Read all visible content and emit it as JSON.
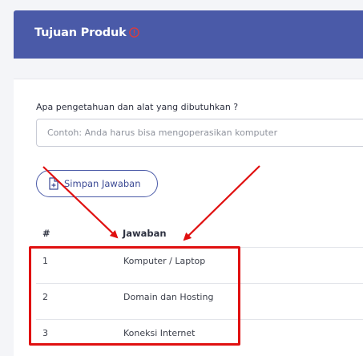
{
  "header": {
    "title": "Tujuan Produk",
    "info_icon": "info-circle-icon",
    "colors": {
      "background": "#4a5aa8",
      "info_icon": "#e53935"
    }
  },
  "form": {
    "question": "Apa pengetahuan dan alat yang dibutuhkan ?",
    "input_value": "",
    "input_placeholder": "Contoh: Anda harus bisa mengoperasikan komputer",
    "save_button_label": "Simpan Jawaban",
    "save_button_icon": "add-file-icon"
  },
  "table": {
    "columns": [
      "#",
      "Jawaban"
    ],
    "rows": [
      {
        "num": "1",
        "answer": "Komputer / Laptop"
      },
      {
        "num": "2",
        "answer": "Domain dan Hosting"
      },
      {
        "num": "3",
        "answer": "Koneksi Internet"
      }
    ]
  },
  "annotations": {
    "highlight_color": "#e01010"
  }
}
